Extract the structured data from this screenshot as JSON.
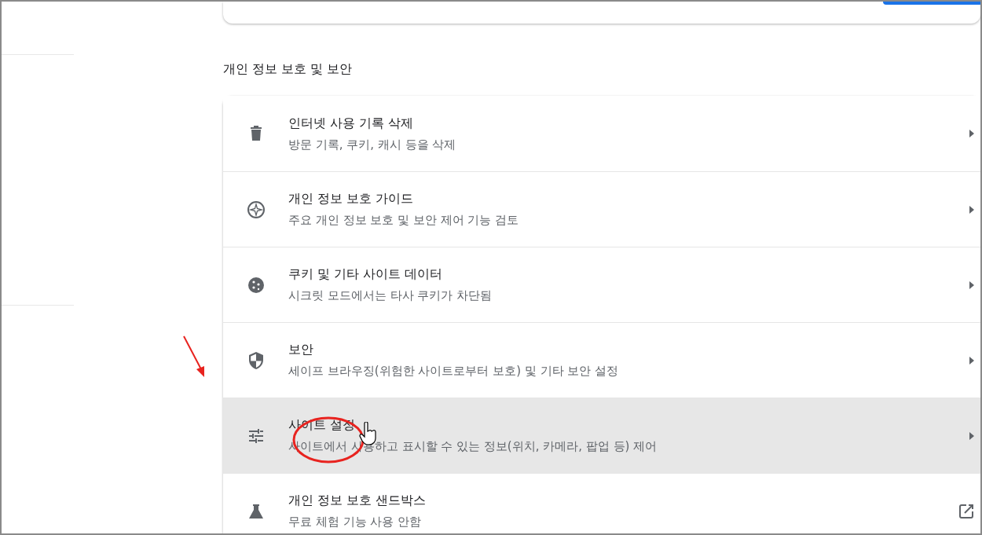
{
  "section_title": "개인 정보 보호 및 보안",
  "rows": [
    {
      "title": "인터넷 사용 기록 삭제",
      "subtitle": "방문 기록, 쿠키, 캐시 등을 삭제",
      "kind": "arrow",
      "hovered": false
    },
    {
      "title": "개인 정보 보호 가이드",
      "subtitle": "주요 개인 정보 보호 및 보안 제어 기능 검토",
      "kind": "arrow",
      "hovered": false
    },
    {
      "title": "쿠키 및 기타 사이트 데이터",
      "subtitle": "시크릿 모드에서는 타사 쿠키가 차단됨",
      "kind": "arrow",
      "hovered": false
    },
    {
      "title": "보안",
      "subtitle": "세이프 브라우징(위험한 사이트로부터 보호) 및 기타 보안 설정",
      "kind": "arrow",
      "hovered": false
    },
    {
      "title": "사이트 설정",
      "subtitle": "사이트에서 사용하고 표시할 수 있는 정보(위치, 카메라, 팝업 등) 제어",
      "kind": "arrow",
      "hovered": true
    },
    {
      "title": "개인 정보 보호 샌드박스",
      "subtitle": "무료 체험 기능 사용 안함",
      "kind": "external",
      "hovered": false
    }
  ]
}
